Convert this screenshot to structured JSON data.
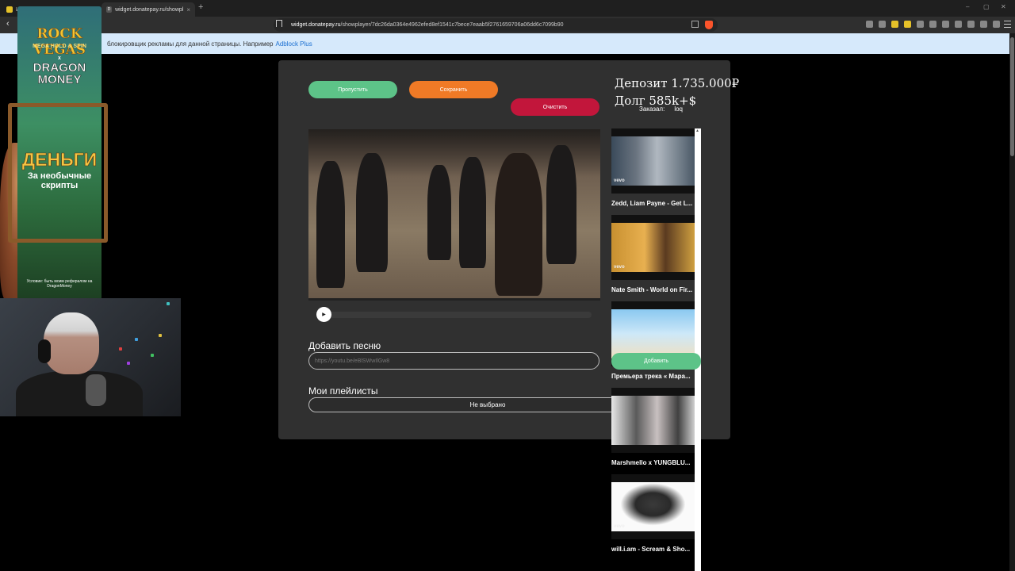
{
  "browser": {
    "tabs": [
      {
        "label": "И",
        "active": false
      },
      {
        "label": "widget.donatepay.ru/showpl",
        "active": true,
        "favicon": "D"
      }
    ],
    "new_tab": "+",
    "url_host": "widget.donatepay.ru",
    "url_path": "/showplayer/7dc26da0364e4962efed8ef1541c7bece7eaab5f2761659706a06dd6c7099b90",
    "window_controls": [
      "–",
      "▢",
      "✕"
    ],
    "infobar_text": "блокировщик рекламы для данной страницы. Например",
    "infobar_link": "Adblock Plus"
  },
  "player": {
    "skip_label": "Пропустить",
    "save_label": "Сохранить",
    "clear_label": "Очистить",
    "deposit_text": "Депозит 1.735.000₽",
    "debt_text": "Долг  585k+$",
    "ordered_label": "Заказал:",
    "ordered_by": "loq",
    "add_song_heading": "Добавить песню",
    "add_song_placeholder": "https://youtu.be/eBlSWwIlGw8",
    "playlists_heading": "Мои плейлисты",
    "playlist_selected": "Не выбрано",
    "progress": 0.0
  },
  "recommendations": {
    "add_label": "Добавить",
    "items": [
      {
        "title": "Zedd, Liam Payne - Get L...",
        "vevo": "vevo"
      },
      {
        "title": "Nate Smith - World on Fir...",
        "vevo": "vevo"
      },
      {
        "title": "Премьера трека « Мара...",
        "vevo": ""
      },
      {
        "title": "Marshmello x YUNGBLU...",
        "vevo": ""
      },
      {
        "title": "will.i.am - Scream & Sho...",
        "vevo": "vevo"
      }
    ]
  },
  "ad": {
    "line1": "ROCK VEGAS",
    "line2": "MEGA HOLD & SPIN",
    "line3": "x",
    "line4": "DRAGON MONEY",
    "headline": "ДЕНЬГИ",
    "sub": "За необычные скрипты",
    "condition": "Условие: быть моим рефералом на DragonMoney"
  },
  "colors": {
    "skip": "#5dc388",
    "save": "#f07a26",
    "clear": "#c2163b",
    "panel": "#303030",
    "infobar": "#d6e9fb"
  }
}
